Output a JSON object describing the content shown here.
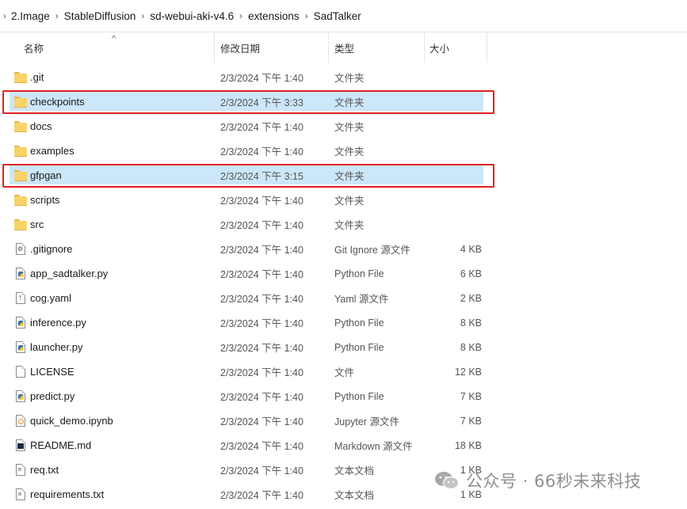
{
  "breadcrumb": [
    "2.Image",
    "StableDiffusion",
    "sd-webui-aki-v4.6",
    "extensions",
    "SadTalker"
  ],
  "columns": {
    "name": "名称",
    "date": "修改日期",
    "type": "类型",
    "size": "大小"
  },
  "rows": [
    {
      "name": ".git",
      "date": "2/3/2024 下午 1:40",
      "type": "文件夹",
      "size": "",
      "icon": "folder-icon",
      "selected": false
    },
    {
      "name": "checkpoints",
      "date": "2/3/2024 下午 3:33",
      "type": "文件夹",
      "size": "",
      "icon": "folder-icon",
      "selected": true
    },
    {
      "name": "docs",
      "date": "2/3/2024 下午 1:40",
      "type": "文件夹",
      "size": "",
      "icon": "folder-icon",
      "selected": false
    },
    {
      "name": "examples",
      "date": "2/3/2024 下午 1:40",
      "type": "文件夹",
      "size": "",
      "icon": "folder-icon",
      "selected": false
    },
    {
      "name": "gfpgan",
      "date": "2/3/2024 下午 3:15",
      "type": "文件夹",
      "size": "",
      "icon": "folder-icon",
      "selected": true
    },
    {
      "name": "scripts",
      "date": "2/3/2024 下午 1:40",
      "type": "文件夹",
      "size": "",
      "icon": "folder-icon",
      "selected": false
    },
    {
      "name": "src",
      "date": "2/3/2024 下午 1:40",
      "type": "文件夹",
      "size": "",
      "icon": "folder-icon",
      "selected": false
    },
    {
      "name": ".gitignore",
      "date": "2/3/2024 下午 1:40",
      "type": "Git Ignore 源文件",
      "size": "4 KB",
      "icon": "gitignore-file-icon",
      "selected": false
    },
    {
      "name": "app_sadtalker.py",
      "date": "2/3/2024 下午 1:40",
      "type": "Python File",
      "size": "6 KB",
      "icon": "python-file-icon",
      "selected": false
    },
    {
      "name": "cog.yaml",
      "date": "2/3/2024 下午 1:40",
      "type": "Yaml 源文件",
      "size": "2 KB",
      "icon": "yaml-file-icon",
      "selected": false
    },
    {
      "name": "inference.py",
      "date": "2/3/2024 下午 1:40",
      "type": "Python File",
      "size": "8 KB",
      "icon": "python-file-icon",
      "selected": false
    },
    {
      "name": "launcher.py",
      "date": "2/3/2024 下午 1:40",
      "type": "Python File",
      "size": "8 KB",
      "icon": "python-file-icon",
      "selected": false
    },
    {
      "name": "LICENSE",
      "date": "2/3/2024 下午 1:40",
      "type": "文件",
      "size": "12 KB",
      "icon": "blank-file-icon",
      "selected": false
    },
    {
      "name": "predict.py",
      "date": "2/3/2024 下午 1:40",
      "type": "Python File",
      "size": "7 KB",
      "icon": "python-file-icon",
      "selected": false
    },
    {
      "name": "quick_demo.ipynb",
      "date": "2/3/2024 下午 1:40",
      "type": "Jupyter 源文件",
      "size": "7 KB",
      "icon": "notebook-file-icon",
      "selected": false
    },
    {
      "name": "README.md",
      "date": "2/3/2024 下午 1:40",
      "type": "Markdown 源文件",
      "size": "18 KB",
      "icon": "markdown-file-icon",
      "selected": false
    },
    {
      "name": "req.txt",
      "date": "2/3/2024 下午 1:40",
      "type": "文本文档",
      "size": "1 KB",
      "icon": "text-file-icon",
      "selected": false
    },
    {
      "name": "requirements.txt",
      "date": "2/3/2024 下午 1:40",
      "type": "文本文档",
      "size": "1 KB",
      "icon": "text-file-icon",
      "selected": false
    }
  ],
  "watermark": {
    "text": "公众号 · 66秒未来科技",
    "icon": "wechat-icon"
  },
  "colors": {
    "selection": "#cce6fa",
    "highlight_box": "#e02020",
    "folder": "#f8d36a"
  }
}
